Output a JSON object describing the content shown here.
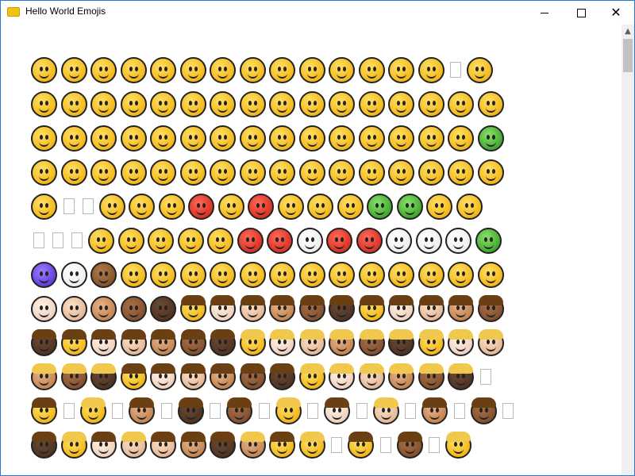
{
  "window": {
    "title": "Hello World Emojis",
    "accent_color": "#2b78d4",
    "controls": [
      "minimize-icon",
      "maximize-icon",
      "close-icon"
    ]
  },
  "emoji_grid": {
    "rows": [
      [
        "grin",
        "grin-teeth",
        "joy",
        "rofl",
        "smiley",
        "smile",
        "sweat-smile",
        "laughing",
        "wink",
        "blush",
        "yum",
        "sunglasses",
        "heart-eyes",
        "kissing-heart",
        "box",
        "kissing"
      ],
      [
        "kissing-smiling",
        "kissing-closed-eyes",
        "smiling-relaxed",
        "slight-smile",
        "hugging",
        "star-struck",
        "thinking",
        "raised-eyebrow",
        "neutral",
        "expressionless",
        "no-mouth",
        "eye-roll",
        "smirk",
        "persevere",
        "disappointed-relieved",
        "open-mouth"
      ],
      [
        "zipper-mouth",
        "hushed",
        "sleepy",
        "tired",
        "sleeping",
        "relieved",
        "tongue",
        "stuck-out-tongue-wink",
        "stuck-out-tongue-closed",
        "drool",
        "unamused",
        "sweat",
        "pensive",
        "confused",
        "upside-down",
        "money-mouth"
      ],
      [
        "astonished",
        "frowning2",
        "slight-frown",
        "confounded",
        "disappointed",
        "worried",
        "triumph",
        "cry",
        "sob",
        "frowning",
        "anguished",
        "fearful",
        "weary",
        "exploding-head",
        "grimace",
        "cold-sweat"
      ],
      [
        "scream",
        "box",
        "box",
        "flushed",
        "zany",
        "dizzy-face",
        "rage",
        "angry",
        "cursing",
        "mask",
        "thermometer",
        "bandage",
        "nauseated",
        "vomit",
        "halo",
        "cowboy"
      ],
      [
        "box",
        "box",
        "box",
        "lying",
        "shush",
        "hand-over-mouth",
        "monocle",
        "nerd",
        "smiling-imp",
        "imp",
        "clown",
        "ogre",
        "goblin",
        "skull",
        "crossbones",
        "ghost",
        "alien"
      ],
      [
        "space-invader",
        "robot",
        "poop",
        "smiley-cat",
        "smile-cat",
        "joy-cat",
        "heart-eyes-cat",
        "smirk-cat",
        "kissing-cat",
        "scream-cat",
        "crying-cat",
        "pouting-cat",
        "see-no-evil",
        "hear-no-evil",
        "speak-no-evil",
        "baby"
      ],
      [
        "baby-tone1",
        "baby-tone2",
        "baby-tone3",
        "baby-tone4",
        "baby-tone5",
        "child",
        "child-tone1",
        "child-tone2",
        "child-tone3",
        "child-tone4",
        "child-tone5",
        "boy",
        "boy-tone1",
        "boy-tone2",
        "boy-tone3",
        "boy-tone4"
      ],
      [
        "boy-tone5",
        "girl",
        "girl-tone1",
        "girl-tone2",
        "girl-tone3",
        "girl-tone4",
        "girl-tone5",
        "adult",
        "adult-tone1",
        "adult-tone2",
        "adult-tone3",
        "adult-tone4",
        "adult-tone5",
        "blond-man",
        "blond-man-tone1",
        "blond-man-tone2"
      ],
      [
        "blond-man-tone3",
        "blond-man-tone4",
        "blond-man-tone5",
        "man",
        "man-tone1",
        "man-tone2",
        "man-tone3",
        "man-tone4",
        "man-tone5",
        "blond-person",
        "blond-person-tone1",
        "blond-person-tone2",
        "blond-person-tone3",
        "blond-person-tone4",
        "blond-person-tone5",
        "box"
      ],
      [
        "man-beard",
        "box",
        "blond-beard",
        "box",
        "man-beard-tone3",
        "box",
        "man-beard-tone5",
        "box",
        "man-beard-tone4",
        "box",
        "blond-man",
        "box",
        "man-beard-tone1",
        "box",
        "blond-man-tone2",
        "box",
        "man-beard-tone3",
        "box",
        "man-beard-tone4",
        "box"
      ],
      [
        "man-tone5",
        "blond-man",
        "man-tone1",
        "blond-man-tone2",
        "man-tone2",
        "man-tone3",
        "man-tone5",
        "blond-man-tone3",
        "man",
        "blond-man",
        "box",
        "man-beard",
        "box",
        "man-tone4",
        "box",
        "blond-man"
      ],
      [
        "row-partial"
      ]
    ]
  }
}
